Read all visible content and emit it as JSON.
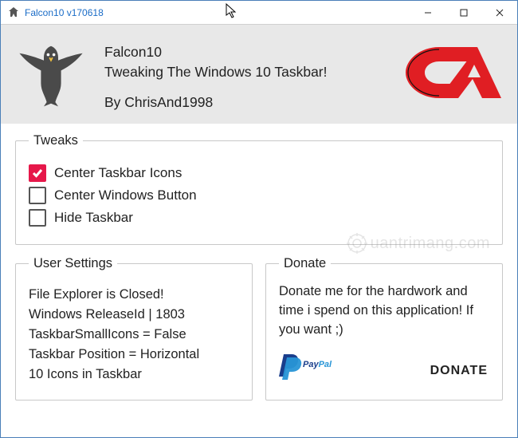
{
  "titlebar": {
    "title": "Falcon10 v170618"
  },
  "header": {
    "app_name": "Falcon10",
    "tagline": "Tweaking The Windows 10 Taskbar!",
    "by": "By ChrisAnd1998"
  },
  "tweaks": {
    "legend": "Tweaks",
    "items": [
      {
        "label": "Center Taskbar Icons",
        "checked": true
      },
      {
        "label": "Center Windows Button",
        "checked": false
      },
      {
        "label": "Hide Taskbar",
        "checked": false
      }
    ]
  },
  "user_settings": {
    "legend": "User Settings",
    "lines": [
      "File Explorer is Closed!",
      "Windows ReleaseId | 1803",
      "TaskbarSmallIcons = False",
      "Taskbar Position = Horizontal",
      "10 Icons in Taskbar"
    ]
  },
  "donate": {
    "legend": "Donate",
    "text": "Donate me for the hardwork and time i spend on this application! If you want ;)",
    "button": "DONATE",
    "paypal_label": "PayPal"
  },
  "watermark": {
    "text": "uantrimang.com"
  }
}
